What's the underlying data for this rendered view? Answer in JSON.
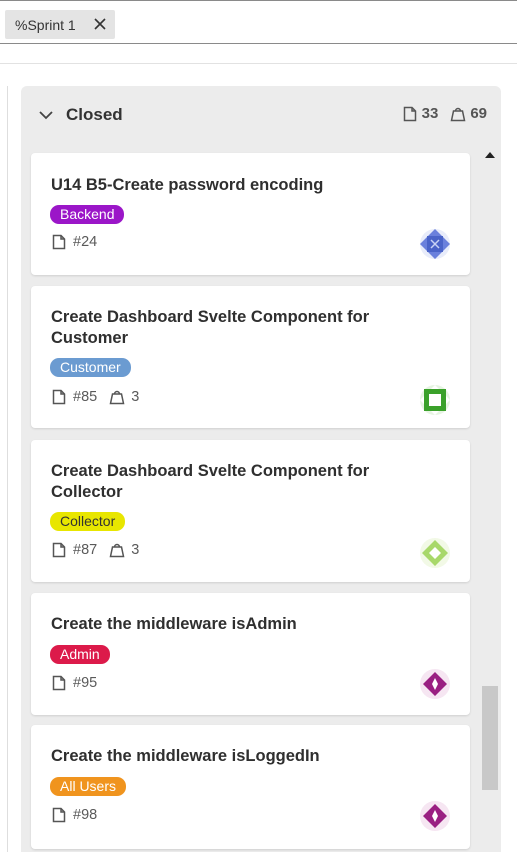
{
  "filter": {
    "label": "%Sprint 1"
  },
  "column": {
    "title": "Closed",
    "issue_count": "33",
    "weight_total": "69"
  },
  "cards": [
    {
      "title": "U14 B5-Create password encoding",
      "tag": "Backend",
      "tag_color": "#9b16c8",
      "issue": "#24",
      "weight": "",
      "avatar_color": "#4a63c8"
    },
    {
      "title": "Create Dashboard Svelte Component for Customer",
      "tag": "Customer",
      "tag_color": "#6b9bd1",
      "issue": "#85",
      "weight": "3",
      "avatar_color": "#3aa12a"
    },
    {
      "title": "Create Dashboard Svelte Component for Collector",
      "tag": "Collector",
      "tag_color": "#e8e600",
      "tag_text_color": "#333333",
      "issue": "#87",
      "weight": "3",
      "avatar_color": "#a8d86a"
    },
    {
      "title": "Create the middleware isAdmin",
      "tag": "Admin",
      "tag_color": "#dc1a4a",
      "issue": "#95",
      "weight": "",
      "avatar_color": "#9a1f82"
    },
    {
      "title": "Create the middleware isLoggedIn",
      "tag": "All Users",
      "tag_color": "#f0941e",
      "issue": "#98",
      "weight": "",
      "avatar_color": "#9a1f82"
    }
  ]
}
